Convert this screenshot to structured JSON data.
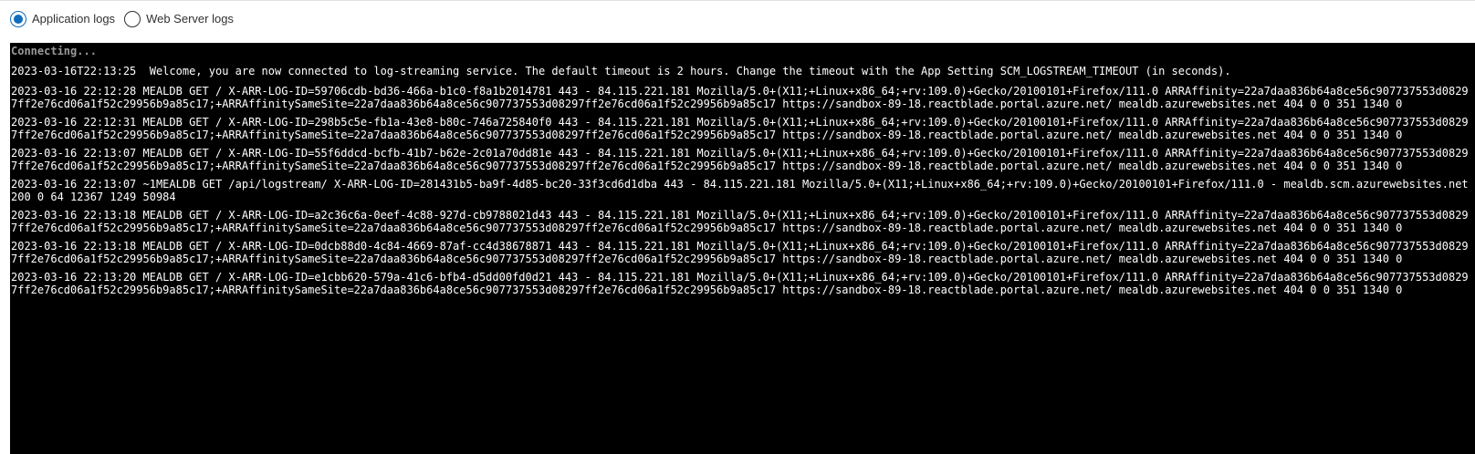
{
  "log_type_selector": {
    "options": [
      {
        "label": "Application logs",
        "selected": true
      },
      {
        "label": "Web Server logs",
        "selected": false
      }
    ],
    "accent_color": "#0f6cbd"
  },
  "console": {
    "status": "Connecting...",
    "welcome": "2023-03-16T22:13:25  Welcome, you are now connected to log-streaming service. The default timeout is 2 hours. Change the timeout with the App Setting SCM_LOGSTREAM_TIMEOUT (in seconds).",
    "entries": [
      "2023-03-16 22:12:28 MEALDB GET / X-ARR-LOG-ID=59706cdb-bd36-466a-b1c0-f8a1b2014781 443 - 84.115.221.181 Mozilla/5.0+(X11;+Linux+x86_64;+rv:109.0)+Gecko/20100101+Firefox/111.0 ARRAffinity=22a7daa836b64a8ce56c907737553d08297ff2e76cd06a1f52c29956b9a85c17;+ARRAffinitySameSite=22a7daa836b64a8ce56c907737553d08297ff2e76cd06a1f52c29956b9a85c17 https://sandbox-89-18.reactblade.portal.azure.net/ mealdb.azurewebsites.net 404 0 0 351 1340 0",
      "2023-03-16 22:12:31 MEALDB GET / X-ARR-LOG-ID=298b5c5e-fb1a-43e8-b80c-746a725840f0 443 - 84.115.221.181 Mozilla/5.0+(X11;+Linux+x86_64;+rv:109.0)+Gecko/20100101+Firefox/111.0 ARRAffinity=22a7daa836b64a8ce56c907737553d08297ff2e76cd06a1f52c29956b9a85c17;+ARRAffinitySameSite=22a7daa836b64a8ce56c907737553d08297ff2e76cd06a1f52c29956b9a85c17 https://sandbox-89-18.reactblade.portal.azure.net/ mealdb.azurewebsites.net 404 0 0 351 1340 0",
      "2023-03-16 22:13:07 MEALDB GET / X-ARR-LOG-ID=55f6ddcd-bcfb-41b7-b62e-2c01a70dd81e 443 - 84.115.221.181 Mozilla/5.0+(X11;+Linux+x86_64;+rv:109.0)+Gecko/20100101+Firefox/111.0 ARRAffinity=22a7daa836b64a8ce56c907737553d08297ff2e76cd06a1f52c29956b9a85c17;+ARRAffinitySameSite=22a7daa836b64a8ce56c907737553d08297ff2e76cd06a1f52c29956b9a85c17 https://sandbox-89-18.reactblade.portal.azure.net/ mealdb.azurewebsites.net 404 0 0 351 1340 0",
      "2023-03-16 22:13:07 ~1MEALDB GET /api/logstream/ X-ARR-LOG-ID=281431b5-ba9f-4d85-bc20-33f3cd6d1dba 443 - 84.115.221.181 Mozilla/5.0+(X11;+Linux+x86_64;+rv:109.0)+Gecko/20100101+Firefox/111.0 - mealdb.scm.azurewebsites.net 200 0 64 12367 1249 50984",
      "2023-03-16 22:13:18 MEALDB GET / X-ARR-LOG-ID=a2c36c6a-0eef-4c88-927d-cb9788021d43 443 - 84.115.221.181 Mozilla/5.0+(X11;+Linux+x86_64;+rv:109.0)+Gecko/20100101+Firefox/111.0 ARRAffinity=22a7daa836b64a8ce56c907737553d08297ff2e76cd06a1f52c29956b9a85c17;+ARRAffinitySameSite=22a7daa836b64a8ce56c907737553d08297ff2e76cd06a1f52c29956b9a85c17 https://sandbox-89-18.reactblade.portal.azure.net/ mealdb.azurewebsites.net 404 0 0 351 1340 0",
      "2023-03-16 22:13:18 MEALDB GET / X-ARR-LOG-ID=0dcb88d0-4c84-4669-87af-cc4d38678871 443 - 84.115.221.181 Mozilla/5.0+(X11;+Linux+x86_64;+rv:109.0)+Gecko/20100101+Firefox/111.0 ARRAffinity=22a7daa836b64a8ce56c907737553d08297ff2e76cd06a1f52c29956b9a85c17;+ARRAffinitySameSite=22a7daa836b64a8ce56c907737553d08297ff2e76cd06a1f52c29956b9a85c17 https://sandbox-89-18.reactblade.portal.azure.net/ mealdb.azurewebsites.net 404 0 0 351 1340 0",
      "2023-03-16 22:13:20 MEALDB GET / X-ARR-LOG-ID=e1cbb620-579a-41c6-bfb4-d5dd00fd0d21 443 - 84.115.221.181 Mozilla/5.0+(X11;+Linux+x86_64;+rv:109.0)+Gecko/20100101+Firefox/111.0 ARRAffinity=22a7daa836b64a8ce56c907737553d08297ff2e76cd06a1f52c29956b9a85c17;+ARRAffinitySameSite=22a7daa836b64a8ce56c907737553d08297ff2e76cd06a1f52c29956b9a85c17 https://sandbox-89-18.reactblade.portal.azure.net/ mealdb.azurewebsites.net 404 0 0 351 1340 0"
    ]
  }
}
